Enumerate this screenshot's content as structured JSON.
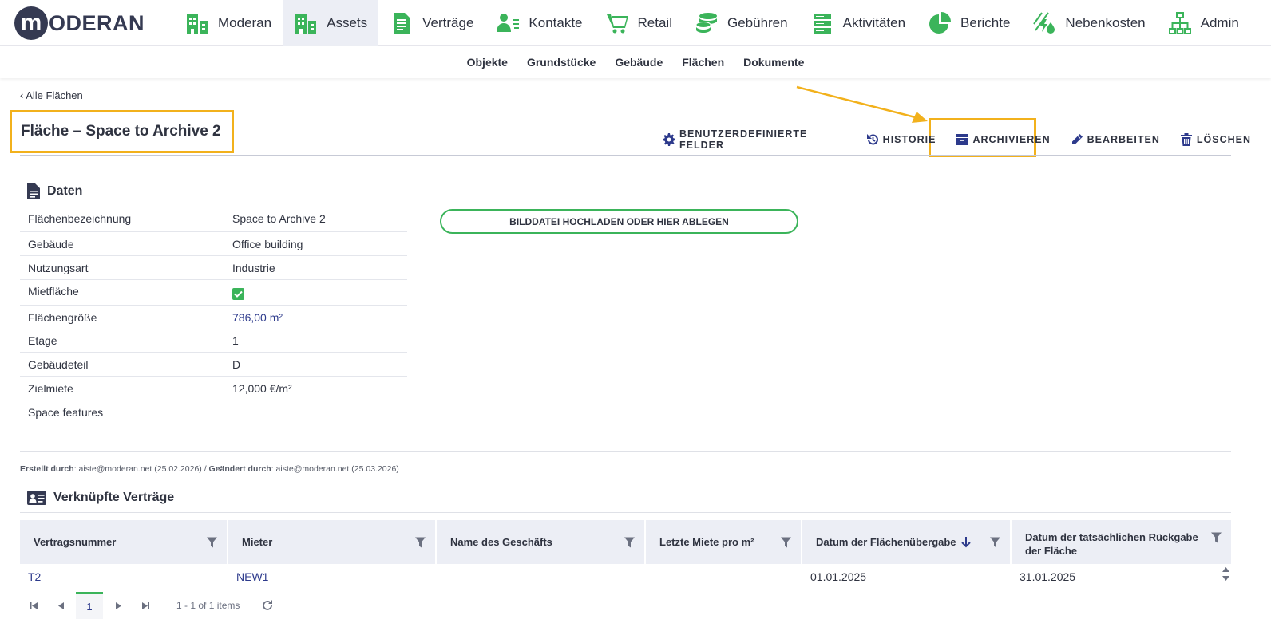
{
  "brand": {
    "logo_letter": "m",
    "logo_text": "ODERAN"
  },
  "nav": {
    "items": [
      {
        "label": "Moderan",
        "icon": "building-icon"
      },
      {
        "label": "Assets",
        "icon": "building-icon",
        "active": true
      },
      {
        "label": "Verträge",
        "icon": "document-icon"
      },
      {
        "label": "Kontakte",
        "icon": "contact-icon"
      },
      {
        "label": "Retail",
        "icon": "cart-icon"
      },
      {
        "label": "Gebühren",
        "icon": "coins-icon"
      },
      {
        "label": "Aktivitäten",
        "icon": "server-icon"
      },
      {
        "label": "Berichte",
        "icon": "pie-chart-icon"
      },
      {
        "label": "Nebenkosten",
        "icon": "utilities-icon"
      },
      {
        "label": "Admin",
        "icon": "org-chart-icon"
      }
    ]
  },
  "subnav": {
    "items": [
      "Objekte",
      "Grundstücke",
      "Gebäude",
      "Flächen",
      "Dokumente"
    ]
  },
  "breadcrumb": {
    "back_label": "‹ Alle Flächen"
  },
  "page": {
    "title": "Fläche – Space to Archive 2"
  },
  "actions": {
    "custom_fields": "BENUTZERDEFINIERTE FELDER",
    "history": "HISTORIE",
    "archive": "ARCHIVIEREN",
    "edit": "BEARBEITEN",
    "delete": "LÖSCHEN"
  },
  "daten": {
    "heading": "Daten",
    "rows": [
      {
        "label": "Flächenbezeichnung",
        "value": "Space to Archive 2"
      },
      {
        "label": "Gebäude",
        "value": "Office building"
      },
      {
        "label": "Nutzungsart",
        "value": "Industrie"
      },
      {
        "label": "Mietfläche",
        "value": "",
        "checked": true
      },
      {
        "label": "Flächengröße",
        "value": "786,00 m²"
      },
      {
        "label": "Etage",
        "value": "1"
      },
      {
        "label": "Gebäudeteil",
        "value": "D"
      },
      {
        "label": "Zielmiete",
        "value": "12,000 €/m²"
      },
      {
        "label": "Space features",
        "value": ""
      }
    ]
  },
  "upload": {
    "label": "BILDDATEI HOCHLADEN ODER HIER ABLEGEN"
  },
  "meta": {
    "created_label": "Erstellt durch",
    "created_value": ": aiste@moderan.net (25.02.2026) / ",
    "changed_label": "Geändert durch",
    "changed_value": ": aiste@moderan.net (25.03.2026)"
  },
  "contracts": {
    "heading": "Verknüpfte Verträge",
    "columns": [
      "Vertragsnummer",
      "Mieter",
      "Name des Geschäfts",
      "Letzte Miete pro m²",
      "Datum der Flächenübergabe",
      "Datum der tatsächlichen Rückgabe der Fläche"
    ],
    "rows": [
      {
        "vertragsnummer": "T2",
        "mieter": "NEW1",
        "name": "",
        "miete": "",
        "uebergabe": "01.01.2025",
        "rueckgabe": "31.01.2025"
      }
    ],
    "pager": {
      "page": "1",
      "info": "1 - 1 of 1 items"
    }
  },
  "colors": {
    "accent_green": "#3bb45a",
    "highlight": "#f2b11c",
    "link_blue": "#2d3a8c",
    "dark": "#353a52"
  }
}
